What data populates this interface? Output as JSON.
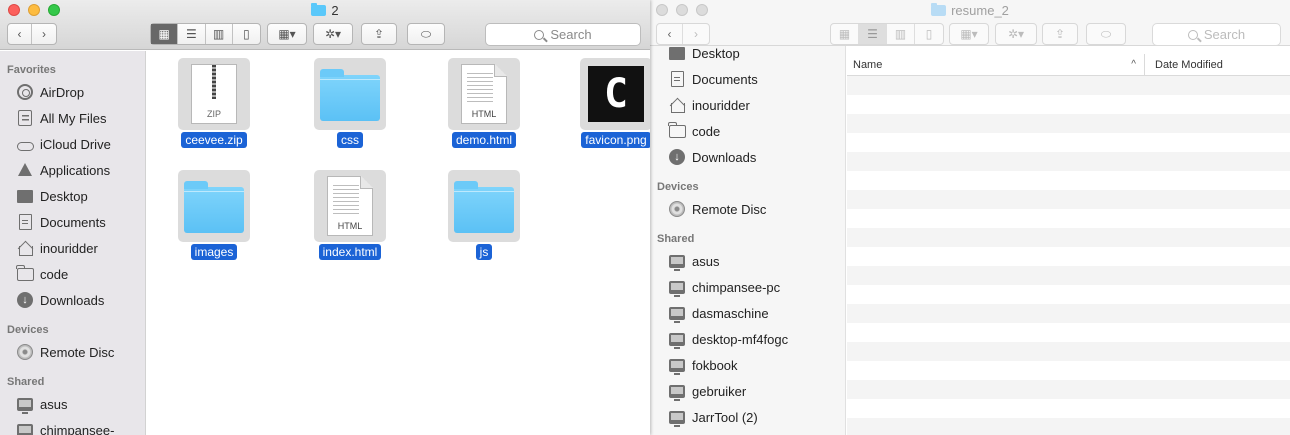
{
  "left_window": {
    "title": "2",
    "search_placeholder": "Search",
    "sidebar": {
      "favorites_header": "Favorites",
      "favorites": [
        {
          "label": "AirDrop",
          "icon": "airdrop-icon"
        },
        {
          "label": "All My Files",
          "icon": "all-files-icon"
        },
        {
          "label": "iCloud Drive",
          "icon": "cloud-icon"
        },
        {
          "label": "Applications",
          "icon": "applications-icon"
        },
        {
          "label": "Desktop",
          "icon": "desktop-icon"
        },
        {
          "label": "Documents",
          "icon": "documents-icon"
        },
        {
          "label": "inouridder",
          "icon": "home-icon"
        },
        {
          "label": "code",
          "icon": "folder-icon"
        },
        {
          "label": "Downloads",
          "icon": "downloads-icon"
        }
      ],
      "devices_header": "Devices",
      "devices": [
        {
          "label": "Remote Disc",
          "icon": "disc-icon"
        }
      ],
      "shared_header": "Shared",
      "shared": [
        {
          "label": "asus",
          "icon": "computer-icon"
        },
        {
          "label": "chimpansee-",
          "icon": "computer-icon"
        }
      ]
    },
    "files": [
      {
        "name": "ceevee.zip",
        "kind": "zip",
        "badge": "ZIP"
      },
      {
        "name": "css",
        "kind": "folder"
      },
      {
        "name": "demo.html",
        "kind": "doc",
        "badge": "HTML"
      },
      {
        "name": "favicon.png",
        "kind": "image",
        "glyph": "C"
      },
      {
        "name": "images",
        "kind": "folder"
      },
      {
        "name": "index.html",
        "kind": "doc",
        "badge": "HTML"
      },
      {
        "name": "js",
        "kind": "folder"
      }
    ]
  },
  "right_window": {
    "title": "resume_2",
    "search_placeholder": "Search",
    "sidebar": {
      "favorites": [
        {
          "label": "Desktop",
          "icon": "desktop-icon"
        },
        {
          "label": "Documents",
          "icon": "documents-icon"
        },
        {
          "label": "inouridder",
          "icon": "home-icon"
        },
        {
          "label": "code",
          "icon": "folder-icon"
        },
        {
          "label": "Downloads",
          "icon": "downloads-icon"
        }
      ],
      "devices_header": "Devices",
      "devices": [
        {
          "label": "Remote Disc",
          "icon": "disc-icon"
        }
      ],
      "shared_header": "Shared",
      "shared": [
        {
          "label": "asus",
          "icon": "computer-icon"
        },
        {
          "label": "chimpansee-pc",
          "icon": "computer-icon"
        },
        {
          "label": "dasmaschine",
          "icon": "computer-icon"
        },
        {
          "label": "desktop-mf4fogc",
          "icon": "computer-icon"
        },
        {
          "label": "fokbook",
          "icon": "computer-icon"
        },
        {
          "label": "gebruiker",
          "icon": "computer-icon"
        },
        {
          "label": "JarrTool (2)",
          "icon": "computer-icon"
        }
      ]
    },
    "columns": {
      "name": "Name",
      "date": "Date Modified"
    },
    "sort_glyph": "^"
  },
  "colors": {
    "selection": "#1b63d6",
    "folder": "#5bc1f5",
    "close": "#fc605c",
    "minimize": "#fdbc40",
    "maximize": "#34c84a"
  }
}
